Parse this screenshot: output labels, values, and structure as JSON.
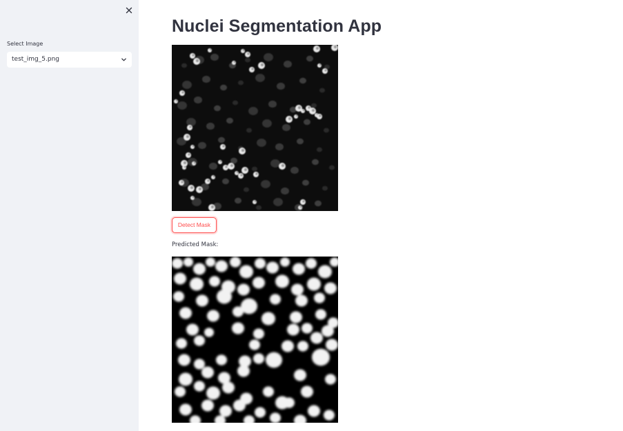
{
  "sidebar": {
    "close_icon": "close-icon",
    "select_label": "Select Image",
    "select_value": "test_img_5.png",
    "select_icon": "chevron-down-icon"
  },
  "main": {
    "title": "Nuclei Segmentation App",
    "detect_button_label": "Detect Mask",
    "predicted_label": "Predicted Mask:"
  },
  "colors": {
    "sidebar_bg": "#f0f2f6",
    "accent": "#ff4b4b",
    "text": "#31333f"
  }
}
